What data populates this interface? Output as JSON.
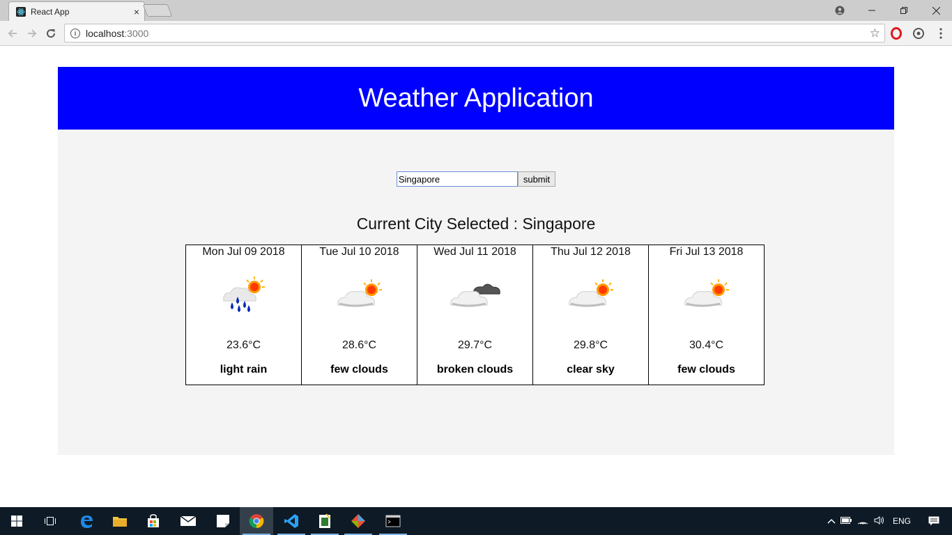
{
  "browser": {
    "tab_title": "React App",
    "tab_close": "×",
    "url_host": "localhost",
    "url_port": ":3000"
  },
  "app": {
    "title": "Weather Application",
    "search_value": "Singapore",
    "submit_label": "submit",
    "city_label": "Current City Selected : Singapore",
    "forecast": [
      {
        "date": "Mon Jul 09 2018",
        "temp": "23.6°C",
        "desc": "light rain",
        "icon": "rain-sun-icon"
      },
      {
        "date": "Tue Jul 10 2018",
        "temp": "28.6°C",
        "desc": "few clouds",
        "icon": "cloud-sun-icon"
      },
      {
        "date": "Wed Jul 11 2018",
        "temp": "29.7°C",
        "desc": "broken clouds",
        "icon": "broken-clouds-icon"
      },
      {
        "date": "Thu Jul 12 2018",
        "temp": "29.8°C",
        "desc": "clear sky",
        "icon": "cloud-sun-icon"
      },
      {
        "date": "Fri Jul 13 2018",
        "temp": "30.4°C",
        "desc": "few clouds",
        "icon": "cloud-sun-icon"
      }
    ]
  },
  "taskbar": {
    "language": "ENG"
  },
  "colors": {
    "header_bg": "#0000ff",
    "app_bg": "#f4f4f4",
    "taskbar_bg": "#0e1a26"
  }
}
